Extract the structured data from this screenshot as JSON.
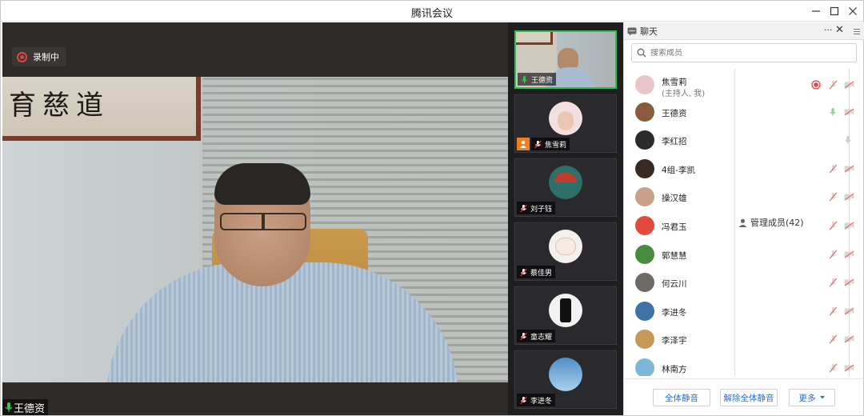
{
  "window": {
    "title": "腾讯会议"
  },
  "main_video": {
    "recording_label": "录制中",
    "speaker_name": "王德资",
    "calligraphy": "育慈道"
  },
  "gallery": [
    {
      "name": "王德资",
      "active": true
    },
    {
      "name": "焦雪莉",
      "host": true
    },
    {
      "name": "刘子钰"
    },
    {
      "name": "蔡佳男"
    },
    {
      "name": "童志耀"
    },
    {
      "name": "李进冬"
    }
  ],
  "panel": {
    "tab_chat": "聊天",
    "tab_members": "管理成员(42)",
    "more_label": "···",
    "close_label": "✕",
    "search_placeholder": "搜索成员",
    "members": [
      {
        "name": "焦雪莉",
        "sub": "(主持人, 我)",
        "avatar_color": "#e8c6c9",
        "mic": "muted",
        "rec": true,
        "cam": "off"
      },
      {
        "name": "王德资",
        "avatar_color": "#8a5a3c",
        "mic": "on",
        "cam": "off"
      },
      {
        "name": "李红招",
        "avatar_color": "#2b2b2b",
        "mic": "idle",
        "cam": "none"
      },
      {
        "name": "4组-李凯",
        "avatar_color": "#3a2a24",
        "mic": "muted",
        "cam": "off"
      },
      {
        "name": "操汉雄",
        "avatar_color": "#c9a08a",
        "mic": "muted",
        "cam": "off"
      },
      {
        "name": "冯君玉",
        "avatar_color": "#e24b3b",
        "mic": "muted",
        "cam": "off"
      },
      {
        "name": "郭慧慧",
        "avatar_color": "#4a8a3e",
        "mic": "muted",
        "cam": "off"
      },
      {
        "name": "何云川",
        "avatar_color": "#6e6a66",
        "mic": "muted",
        "cam": "off"
      },
      {
        "name": "李进冬",
        "avatar_color": "#3e73a8",
        "mic": "muted",
        "cam": "off"
      },
      {
        "name": "李泽宇",
        "avatar_color": "#c89858",
        "mic": "muted",
        "cam": "off"
      },
      {
        "name": "林南方",
        "avatar_color": "#7db7d8",
        "mic": "muted",
        "cam": "off"
      }
    ],
    "footer": {
      "mute_all": "全体静音",
      "unmute_all": "解除全体静音",
      "more": "更多"
    }
  },
  "colors": {
    "accent_blue": "#1f6fd6",
    "active_green": "#2fbf4a",
    "record_red": "#e64343",
    "muted_red": "#e66a6a",
    "host_orange": "#f07d1e"
  }
}
